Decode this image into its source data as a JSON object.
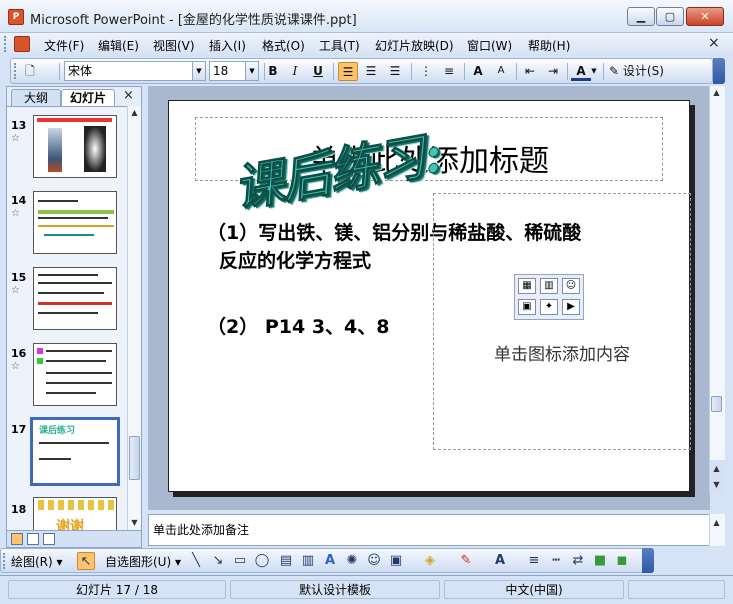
{
  "window": {
    "title": "Microsoft PowerPoint - [金屋的化学性质说课课件.ppt]",
    "app_icon": "powerpoint-icon",
    "controls": {
      "minimize": "▁",
      "maximize": "▢",
      "close": "✕"
    }
  },
  "menu": {
    "items": [
      "文件(F)",
      "编辑(E)",
      "视图(V)",
      "插入(I)",
      "格式(O)",
      "工具(T)",
      "幻灯片放映(D)",
      "窗口(W)",
      "帮助(H)"
    ],
    "close": "×"
  },
  "toolbar": {
    "font_name": "宋体",
    "font_size": "18",
    "bold": "B",
    "italic": "I",
    "underline": "U",
    "design_label": "设计(S)",
    "grow_font": "A",
    "shrink_font": "A",
    "font_color": "A"
  },
  "left_panel": {
    "tab_outline": "大纲",
    "tab_slides": "幻灯片",
    "close": "×",
    "slides": [
      {
        "num": "13"
      },
      {
        "num": "14"
      },
      {
        "num": "15"
      },
      {
        "num": "16"
      },
      {
        "num": "17"
      },
      {
        "num": "18"
      }
    ],
    "thumb17_title": "课后练习",
    "thumb18_text": "谢谢"
  },
  "slide": {
    "title_placeholder": "单击此处添加标题",
    "wordart": "课后练习:",
    "line1": "（1）写出铁、镁、铝分别与稀盐酸、稀硫酸",
    "line1b": "反应的化学方程式",
    "line2": "（2） P14  3、4、8",
    "content_placeholder": "单击图标添加内容"
  },
  "notes": {
    "placeholder": "单击此处添加备注"
  },
  "drawing_toolbar": {
    "draw_label": "绘图(R)",
    "autoshapes_label": "自选图形(U)"
  },
  "status": {
    "slide_count": "幻灯片 17 / 18",
    "design": "默认设计模板",
    "language": "中文(中国)"
  }
}
